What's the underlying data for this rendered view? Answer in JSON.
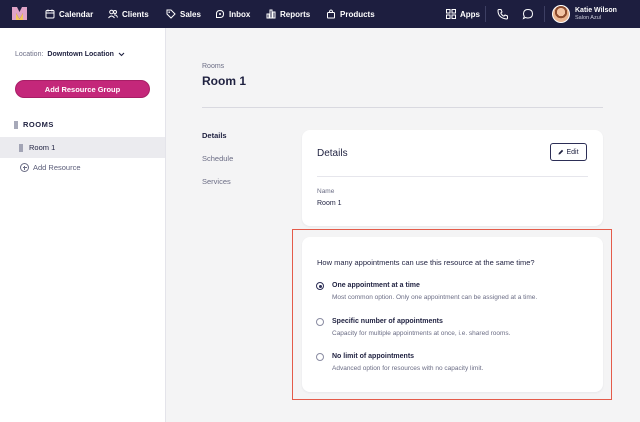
{
  "nav": {
    "items": [
      {
        "label": "Calendar",
        "icon": "calendar-icon"
      },
      {
        "label": "Clients",
        "icon": "clients-icon"
      },
      {
        "label": "Sales",
        "icon": "tag-icon"
      },
      {
        "label": "Inbox",
        "icon": "inbox-icon"
      },
      {
        "label": "Reports",
        "icon": "bar-chart-icon"
      },
      {
        "label": "Products",
        "icon": "bag-icon"
      }
    ],
    "apps_label": "Apps",
    "user_name": "Katie Wilson",
    "salon_name": "Salon Azul",
    "bg_color": "#1d1e3f"
  },
  "sidebar": {
    "location_label": "Location:",
    "location_value": "Downtown Location",
    "add_group_label": "Add Resource Group",
    "section_title": "ROOMS",
    "room_item": "Room 1",
    "add_resource_label": "Add Resource",
    "accent_color": "#c4277a"
  },
  "main": {
    "breadcrumb": "Rooms",
    "title": "Room 1",
    "subnav": [
      "Details",
      "Schedule",
      "Services"
    ],
    "details_card": {
      "title": "Details",
      "edit_label": "Edit",
      "field_label": "Name",
      "field_value": "Room 1"
    },
    "capacity_card": {
      "question": "How many appointments can use this resource at the same time?",
      "options": [
        {
          "title": "One appointment at a time",
          "desc": "Most common option. Only one appointment can be assigned at a time.",
          "selected": true
        },
        {
          "title": "Specific number of appointments",
          "desc": "Capacity for multiple appointments at once, i.e. shared rooms.",
          "selected": false
        },
        {
          "title": "No limit of appointments",
          "desc": "Advanced option for resources with no capacity limit.",
          "selected": false
        }
      ],
      "highlight_color": "#e45b4a"
    }
  }
}
